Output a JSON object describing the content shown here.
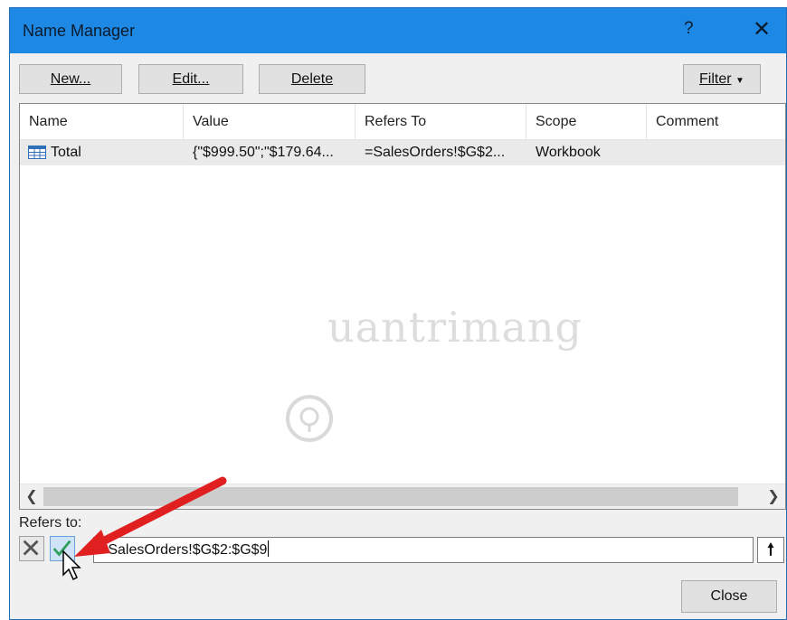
{
  "window": {
    "title": "Name Manager",
    "help_label": "?",
    "close_label": "✕"
  },
  "toolbar": {
    "new_label": "New...",
    "edit_label": "Edit...",
    "delete_label": "Delete",
    "filter_label": "Filter"
  },
  "list": {
    "columns": [
      "Name",
      "Value",
      "Refers To",
      "Scope",
      "Comment"
    ],
    "rows": [
      {
        "icon": "table-icon",
        "name": "Total",
        "value": "{\"$999.50\";\"$179.64...",
        "refers_to": "=SalesOrders!$G$2...",
        "scope": "Workbook",
        "comment": ""
      }
    ]
  },
  "refers_to": {
    "label": "Refers to:",
    "value": "=SalesOrders!$G$2:$G$9"
  },
  "footer": {
    "close_label": "Close"
  },
  "watermark": {
    "text": "uantrimang"
  },
  "colors": {
    "titlebar": "#1e88e5",
    "arrow": "#e02020",
    "confirm_check": "#2e9e5b"
  }
}
